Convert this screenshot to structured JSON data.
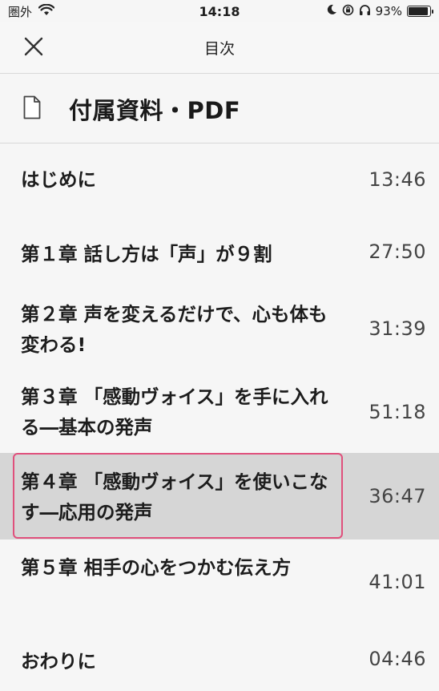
{
  "status_bar": {
    "carrier": "圏外",
    "time": "14:18",
    "battery_percent": "93%",
    "battery_level": 0.93
  },
  "nav": {
    "title": "目次",
    "close_icon": "close-icon"
  },
  "attachment": {
    "label": "付属資料・PDF",
    "icon": "document-icon"
  },
  "chapters": [
    {
      "title": "はじめに",
      "time": "13:46"
    },
    {
      "title": "第１章 話し方は「声」が９割",
      "time": "27:50"
    },
    {
      "title": "第２章 声を変えるだけで、心も体も変わる!",
      "time": "31:39"
    },
    {
      "title": "第３章 「感動ヴォイス」を手に入れる―基本の発声",
      "time": "51:18"
    },
    {
      "title": "第４章 「感動ヴォイス」を使いこなす―応用の発声",
      "time": "36:47",
      "selected": true
    },
    {
      "title": "第５章 相手の心をつかむ伝え方",
      "time": "41:01"
    },
    {
      "title": "おわりに",
      "time": "04:46"
    }
  ],
  "colors": {
    "highlight_border": "#e0507c",
    "selected_bg": "#d6d6d6",
    "background": "#f6f6f6"
  }
}
